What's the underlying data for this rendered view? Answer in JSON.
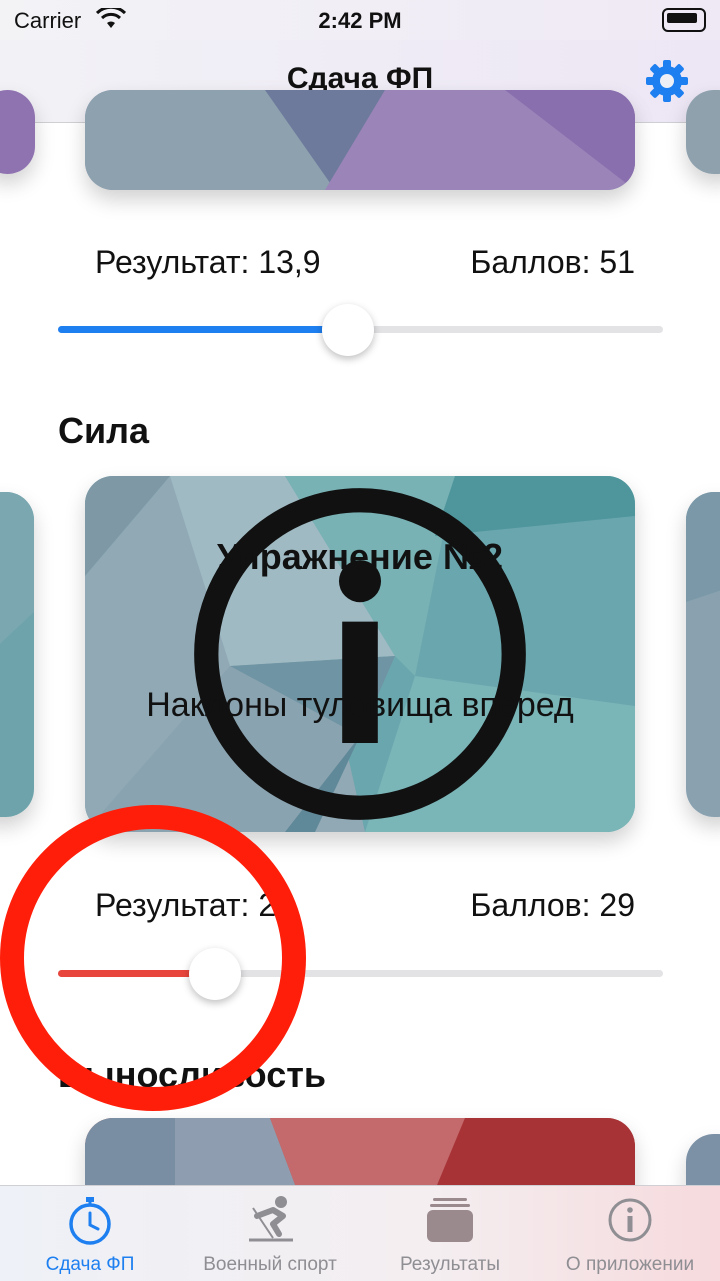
{
  "status_bar": {
    "carrier": "Carrier",
    "time": "2:42 PM"
  },
  "nav": {
    "title": "Сдача ФП",
    "settings_icon": "gear-icon"
  },
  "sections": [
    {
      "result_label": "Результат: 13,9",
      "score_label": "Баллов: 51",
      "slider_fraction": 0.48,
      "slider_color": "#1e7ff0"
    },
    {
      "title": "Сила",
      "card_title": "Упражнение №2",
      "card_subtitle": "Наклоны туловища вперед",
      "result_label": "Результат: 29",
      "score_label": "Баллов: 29",
      "slider_fraction": 0.26,
      "slider_color": "#e8453c"
    },
    {
      "title": "Выносливость"
    }
  ],
  "tabs": [
    {
      "label": "Сдача ФП",
      "icon": "stopwatch-icon",
      "active": true
    },
    {
      "label": "Военный спорт",
      "icon": "skier-icon",
      "active": false
    },
    {
      "label": "Результаты",
      "icon": "stack-icon",
      "active": false
    },
    {
      "label": "О приложении",
      "icon": "info-icon",
      "active": false
    }
  ],
  "colors": {
    "accent": "#1e7ff0",
    "annotation_ring": "#ff1e0a"
  }
}
